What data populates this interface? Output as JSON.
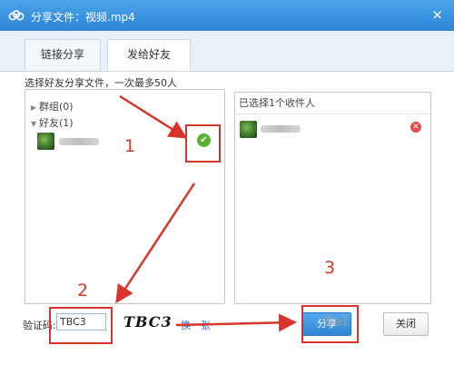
{
  "window": {
    "title": "分享文件：视频.mp4",
    "close_glyph": "×"
  },
  "tabs": [
    {
      "label": "链接分享"
    },
    {
      "label": "发给好友"
    }
  ],
  "instruction": "选择好友分享文件，一次最多50人",
  "friend_tree": {
    "groups_label": "群组(0)",
    "friends_label": "好友(1)"
  },
  "recipients": {
    "header": "已选择1个收件人"
  },
  "captcha": {
    "label": "验证码:",
    "input_value": "TBC3",
    "image_text": "TBC3",
    "refresh_label": "换一张"
  },
  "buttons": {
    "share": "分享",
    "cancel": "关闭"
  },
  "annotations": {
    "step1": "1",
    "step2": "2",
    "step3": "3"
  },
  "watermark_text": "Bai",
  "icons": {
    "logo": "cloud-logo-icon",
    "close": "close-icon",
    "check": "check-icon",
    "remove": "remove-icon"
  },
  "colors": {
    "titlebar": "#2f86d6",
    "annotation_red": "#d9342b",
    "check_green": "#58b32f",
    "remove_red": "#e34b4b"
  }
}
